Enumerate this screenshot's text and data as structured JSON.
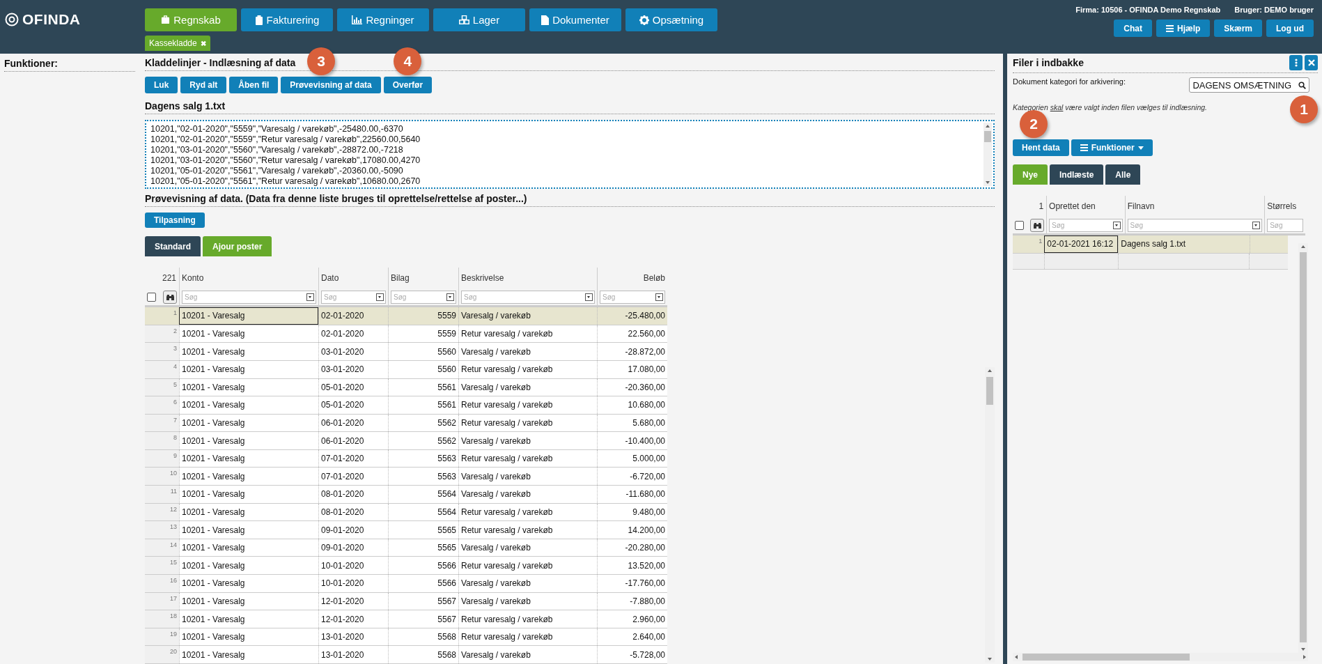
{
  "brand": "OFINDA",
  "nav": [
    {
      "label": "Regnskab",
      "selected": true
    },
    {
      "label": "Fakturering",
      "selected": false
    },
    {
      "label": "Regninger",
      "selected": false
    },
    {
      "label": "Lager",
      "selected": false
    },
    {
      "label": "Dokumenter",
      "selected": false
    },
    {
      "label": "Opsætning",
      "selected": false
    }
  ],
  "open_tabs": [
    {
      "label": "Kassekladde",
      "close": "✖"
    }
  ],
  "header_info": {
    "firma": "Firma: 10506 - OFINDA Demo Regnskab",
    "bruger": "Bruger: DEMO bruger"
  },
  "header_buttons": [
    {
      "label": "Chat"
    },
    {
      "label": "Hjælp"
    },
    {
      "label": "Skærm"
    },
    {
      "label": "Log ud"
    }
  ],
  "sidebar": {
    "title": "Funktioner:"
  },
  "main": {
    "title": "Kladdelinjer - Indlæsning af data",
    "buttons": [
      {
        "label": "Luk"
      },
      {
        "label": "Ryd alt"
      },
      {
        "label": "Åben fil"
      },
      {
        "label": "Prøvevisning af data",
        "callout": "3"
      },
      {
        "label": "Overfør",
        "callout": "4"
      }
    ],
    "file_title": "Dagens salg 1.txt",
    "file_lines": [
      "10201,\"02-01-2020\",\"5559\",\"Varesalg / varekøb\",-25480.00,-6370",
      "10201,\"02-01-2020\",\"5559\",\"Retur varesalg / varekøb\",22560.00,5640",
      "10201,\"03-01-2020\",\"5560\",\"Varesalg / varekøb\",-28872.00,-7218",
      "10201,\"03-01-2020\",\"5560\",\"Retur varesalg / varekøb\",17080.00,4270",
      "10201,\"05-01-2020\",\"5561\",\"Varesalg / varekøb\",-20360.00,-5090",
      "10201,\"05-01-2020\",\"5561\",\"Retur varesalg / varekøb\",10680.00,2670"
    ],
    "preview_title": "Prøvevisning af data. (Data fra denne liste bruges til oprettelse/rettelse af poster...)",
    "customize_button": "Tilpasning",
    "tabs": [
      {
        "label": "Standard",
        "selected": false
      },
      {
        "label": "Ajour poster",
        "selected": true
      }
    ],
    "table": {
      "count": "221",
      "select_all_checked": false,
      "columns": [
        {
          "label": "Konto",
          "placeholder": "Søg"
        },
        {
          "label": "Dato",
          "placeholder": "Søg"
        },
        {
          "label": "Bilag",
          "placeholder": "Søg"
        },
        {
          "label": "Beskrivelse",
          "placeholder": "Søg"
        },
        {
          "label": "Beløb",
          "placeholder": "Søg"
        }
      ],
      "rows": [
        {
          "n": "1",
          "selected": true,
          "cells": [
            "10201 - Varesalg",
            "02-01-2020",
            "5559",
            "Varesalg / varekøb",
            "-25.480,00"
          ]
        },
        {
          "n": "2",
          "selected": false,
          "cells": [
            "10201 - Varesalg",
            "02-01-2020",
            "5559",
            "Retur varesalg / varekøb",
            "22.560,00"
          ]
        },
        {
          "n": "3",
          "selected": false,
          "cells": [
            "10201 - Varesalg",
            "03-01-2020",
            "5560",
            "Varesalg / varekøb",
            "-28.872,00"
          ]
        },
        {
          "n": "4",
          "selected": false,
          "cells": [
            "10201 - Varesalg",
            "03-01-2020",
            "5560",
            "Retur varesalg / varekøb",
            "17.080,00"
          ]
        },
        {
          "n": "5",
          "selected": false,
          "cells": [
            "10201 - Varesalg",
            "05-01-2020",
            "5561",
            "Varesalg / varekøb",
            "-20.360,00"
          ]
        },
        {
          "n": "6",
          "selected": false,
          "cells": [
            "10201 - Varesalg",
            "05-01-2020",
            "5561",
            "Retur varesalg / varekøb",
            "10.680,00"
          ]
        },
        {
          "n": "7",
          "selected": false,
          "cells": [
            "10201 - Varesalg",
            "06-01-2020",
            "5562",
            "Retur varesalg / varekøb",
            "5.680,00"
          ]
        },
        {
          "n": "8",
          "selected": false,
          "cells": [
            "10201 - Varesalg",
            "06-01-2020",
            "5562",
            "Varesalg / varekøb",
            "-10.400,00"
          ]
        },
        {
          "n": "9",
          "selected": false,
          "cells": [
            "10201 - Varesalg",
            "07-01-2020",
            "5563",
            "Retur varesalg / varekøb",
            "5.000,00"
          ]
        },
        {
          "n": "10",
          "selected": false,
          "cells": [
            "10201 - Varesalg",
            "07-01-2020",
            "5563",
            "Varesalg / varekøb",
            "-6.720,00"
          ]
        },
        {
          "n": "11",
          "selected": false,
          "cells": [
            "10201 - Varesalg",
            "08-01-2020",
            "5564",
            "Varesalg / varekøb",
            "-11.680,00"
          ]
        },
        {
          "n": "12",
          "selected": false,
          "cells": [
            "10201 - Varesalg",
            "08-01-2020",
            "5564",
            "Retur varesalg / varekøb",
            "9.480,00"
          ]
        },
        {
          "n": "13",
          "selected": false,
          "cells": [
            "10201 - Varesalg",
            "09-01-2020",
            "5565",
            "Retur varesalg / varekøb",
            "14.200,00"
          ]
        },
        {
          "n": "14",
          "selected": false,
          "cells": [
            "10201 - Varesalg",
            "09-01-2020",
            "5565",
            "Varesalg / varekøb",
            "-20.280,00"
          ]
        },
        {
          "n": "15",
          "selected": false,
          "cells": [
            "10201 - Varesalg",
            "10-01-2020",
            "5566",
            "Retur varesalg / varekøb",
            "13.520,00"
          ]
        },
        {
          "n": "16",
          "selected": false,
          "cells": [
            "10201 - Varesalg",
            "10-01-2020",
            "5566",
            "Varesalg / varekøb",
            "-17.760,00"
          ]
        },
        {
          "n": "17",
          "selected": false,
          "cells": [
            "10201 - Varesalg",
            "12-01-2020",
            "5567",
            "Varesalg / varekøb",
            "-7.880,00"
          ]
        },
        {
          "n": "18",
          "selected": false,
          "cells": [
            "10201 - Varesalg",
            "12-01-2020",
            "5567",
            "Retur varesalg / varekøb",
            "2.960,00"
          ]
        },
        {
          "n": "19",
          "selected": false,
          "cells": [
            "10201 - Varesalg",
            "13-01-2020",
            "5568",
            "Retur varesalg / varekøb",
            "2.640,00"
          ]
        },
        {
          "n": "20",
          "selected": false,
          "cells": [
            "10201 - Varesalg",
            "13-01-2020",
            "5568",
            "Varesalg / varekøb",
            "-5.728,00"
          ]
        }
      ]
    }
  },
  "inbox": {
    "title": "Filer i indbakke",
    "category_label": "Dokument kategori for arkivering:",
    "category_value": "DAGENS OMSÆTNING",
    "category_callout": "1",
    "note": {
      "before": "Kategorien ",
      "underlined": "skal",
      "after": " være valgt inden filen vælges til indlæsning."
    },
    "fetch_button": {
      "label": "Hent data",
      "callout": "2"
    },
    "functions_button": "Funktioner",
    "tabs": [
      {
        "label": "Nye",
        "selected": true
      },
      {
        "label": "Indlæste",
        "selected": false
      },
      {
        "label": "Alle",
        "selected": false
      }
    ],
    "table": {
      "count": "1",
      "select_all_checked": false,
      "columns": [
        {
          "label": "Oprettet den",
          "placeholder": "Søg"
        },
        {
          "label": "Filnavn",
          "placeholder": "Søg"
        },
        {
          "label": "Størrels",
          "placeholder": "Søg"
        }
      ],
      "rows": [
        {
          "n": "1",
          "selected": true,
          "cells": [
            "02-01-2021 16:12",
            "Dagens salg 1.txt"
          ]
        }
      ]
    }
  }
}
